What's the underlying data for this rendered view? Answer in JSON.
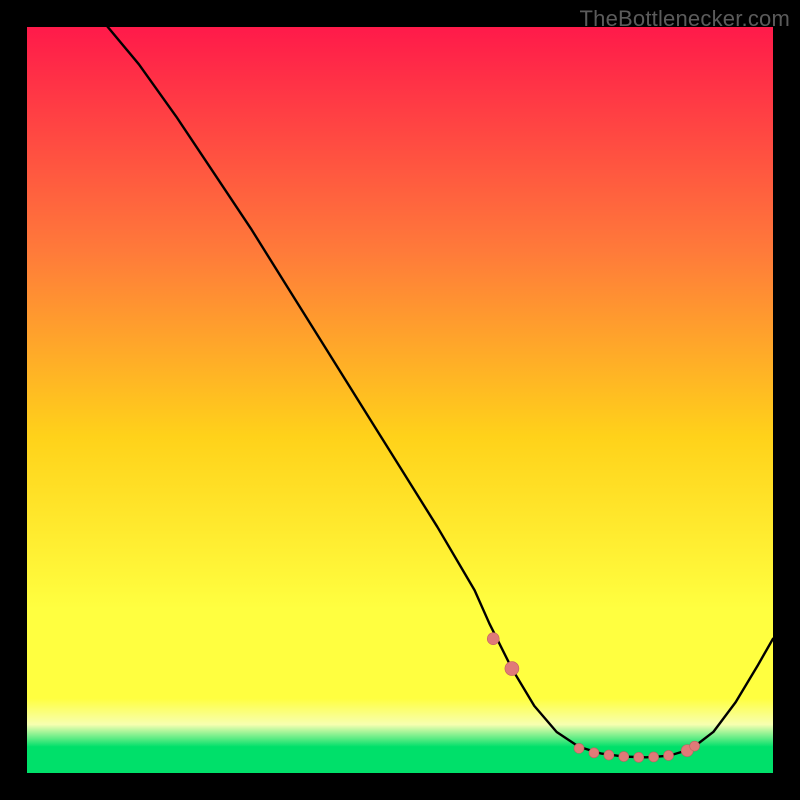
{
  "watermark": "TheBottlenecker.com",
  "colors": {
    "gradient_top": "#ff1a4a",
    "gradient_mid1": "#ff7a3a",
    "gradient_mid2": "#ffd21a",
    "gradient_mid3": "#ffff40",
    "gradient_bottom_band": "#f7ffb0",
    "gradient_bottom": "#00e06a",
    "curve": "#000000",
    "marker_fill": "#e07a78",
    "marker_stroke": "#c06060"
  },
  "chart_data": {
    "type": "line",
    "title": "",
    "xlabel": "",
    "ylabel": "",
    "xlim": [
      0,
      100
    ],
    "ylim": [
      0,
      100
    ],
    "curve": {
      "x": [
        0,
        5,
        10,
        15,
        20,
        25,
        30,
        35,
        40,
        45,
        50,
        55,
        60,
        62,
        65,
        68,
        71,
        74,
        77,
        80,
        83,
        86,
        89,
        92,
        95,
        98,
        100
      ],
      "y": [
        110,
        106,
        101,
        95,
        88,
        80.5,
        73,
        65,
        57,
        49,
        41,
        33,
        24.5,
        20,
        14,
        9,
        5.5,
        3.5,
        2.6,
        2.2,
        2.1,
        2.3,
        3.2,
        5.5,
        9.5,
        14.5,
        18
      ]
    },
    "markers": {
      "x": [
        62.5,
        65,
        74,
        76,
        78,
        80,
        82,
        84,
        86,
        88.5,
        89.5
      ],
      "y": [
        18,
        14,
        3.3,
        2.7,
        2.4,
        2.2,
        2.1,
        2.15,
        2.35,
        3.0,
        3.6
      ],
      "size": [
        6,
        7,
        5,
        5,
        5,
        5,
        5,
        5,
        5,
        6,
        5
      ]
    }
  }
}
